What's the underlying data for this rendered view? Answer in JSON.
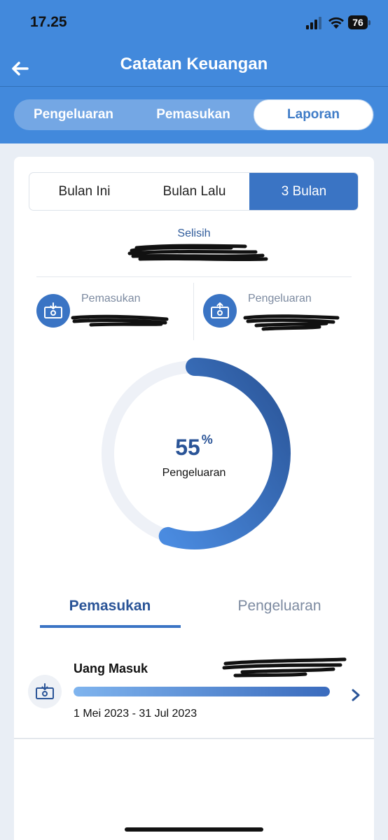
{
  "status_bar": {
    "time": "17.25",
    "battery": "76"
  },
  "header": {
    "title": "Catatan Keuangan",
    "tabs": [
      "Pengeluaran",
      "Pemasukan",
      "Laporan"
    ],
    "active_tab": "Laporan"
  },
  "period": {
    "tabs": [
      "Bulan Ini",
      "Bulan Lalu",
      "3 Bulan"
    ],
    "active": "3 Bulan"
  },
  "summary": {
    "selisih_label": "Selisih",
    "income_label": "Pemasukan",
    "expense_label": "Pengeluaran"
  },
  "donut": {
    "percent": "55",
    "percent_symbol": "%",
    "label": "Pengeluaran",
    "value_fraction": 0.55
  },
  "detail": {
    "tabs": [
      "Pemasukan",
      "Pengeluaran"
    ],
    "active": "Pemasukan",
    "items": [
      {
        "title": "Uang Masuk",
        "date_range": "1 Mei 2023 - 31 Jul 2023",
        "bar_fraction": 1.0
      }
    ]
  },
  "colors": {
    "header_blue": "#4289dc",
    "accent_blue": "#3a74c4",
    "dark_blue": "#2a5497"
  }
}
